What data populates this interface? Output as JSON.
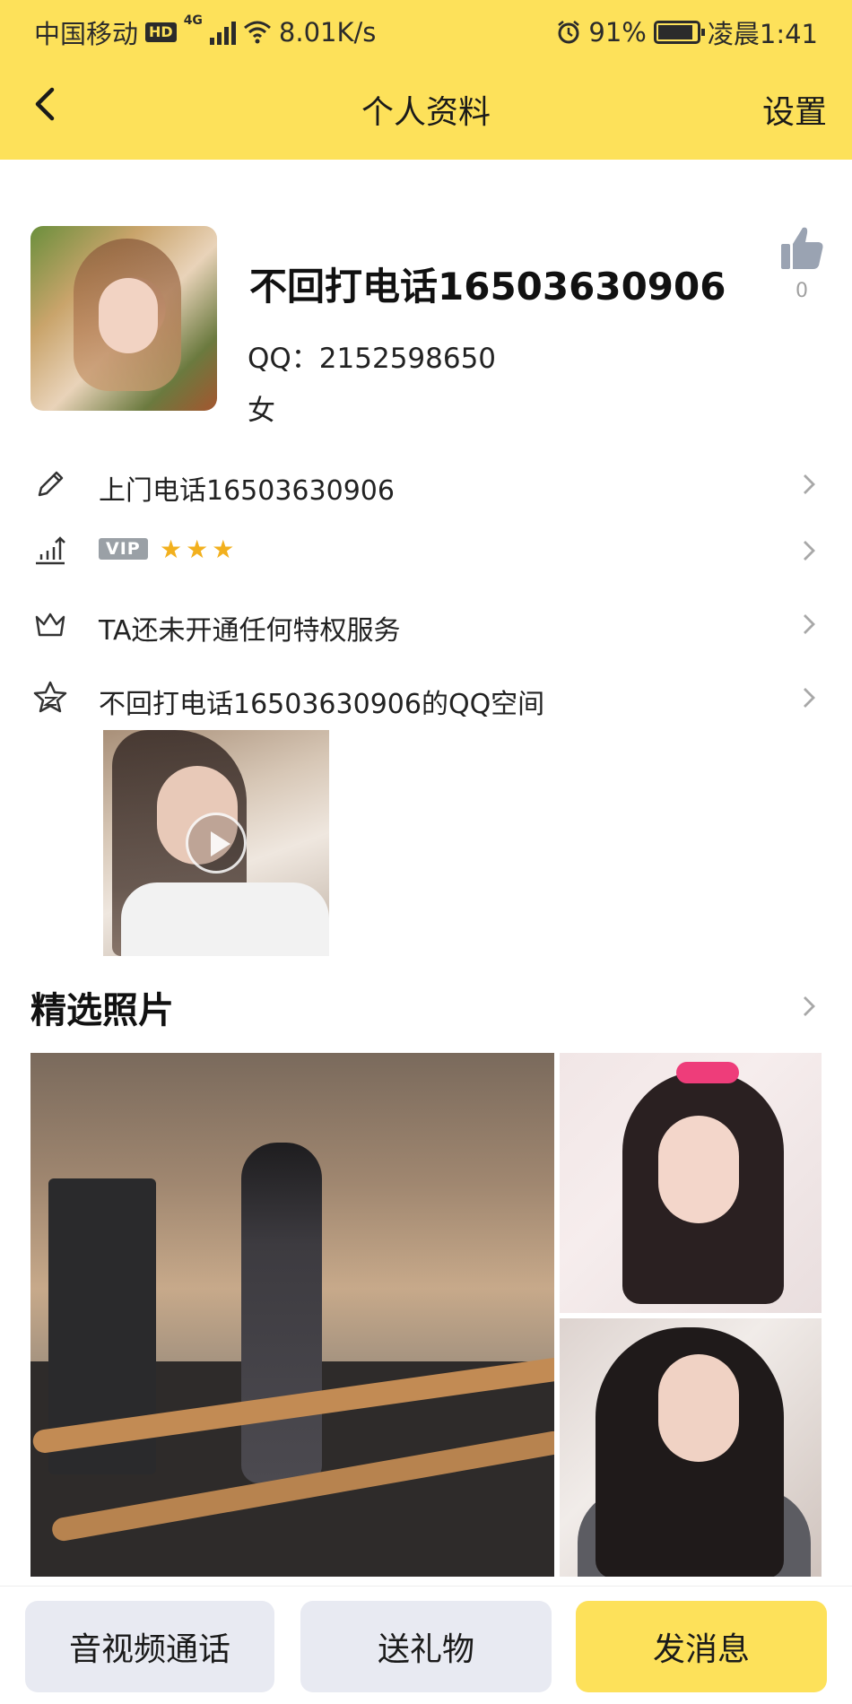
{
  "status": {
    "carrier": "中国移动",
    "hd": "HD",
    "network": "4G",
    "speed": "8.01K/s",
    "battery": "91%",
    "battery_level": 0.91,
    "time": "凌晨1:41"
  },
  "header": {
    "title": "个人资料",
    "settings": "设置",
    "back_icon": "back-arrow-icon"
  },
  "profile": {
    "name": "不回打电话16503630906",
    "qq": "QQ：2152598650",
    "gender": "女",
    "likes": "0"
  },
  "rows": {
    "signature": "上门电话16503630906",
    "vip_badge": "VIP",
    "stars": [
      "★",
      "★",
      "★"
    ],
    "privilege": "TA还未开通任何特权服务",
    "qzone": "不回打电话16503630906的QQ空间"
  },
  "featured": {
    "title": "精选照片"
  },
  "actions": {
    "call": "音视频通话",
    "gift": "送礼物",
    "message": "发消息"
  },
  "colors": {
    "accent": "#fde15a",
    "button_bg": "#e8eaf2",
    "star": "#f2b01e"
  }
}
